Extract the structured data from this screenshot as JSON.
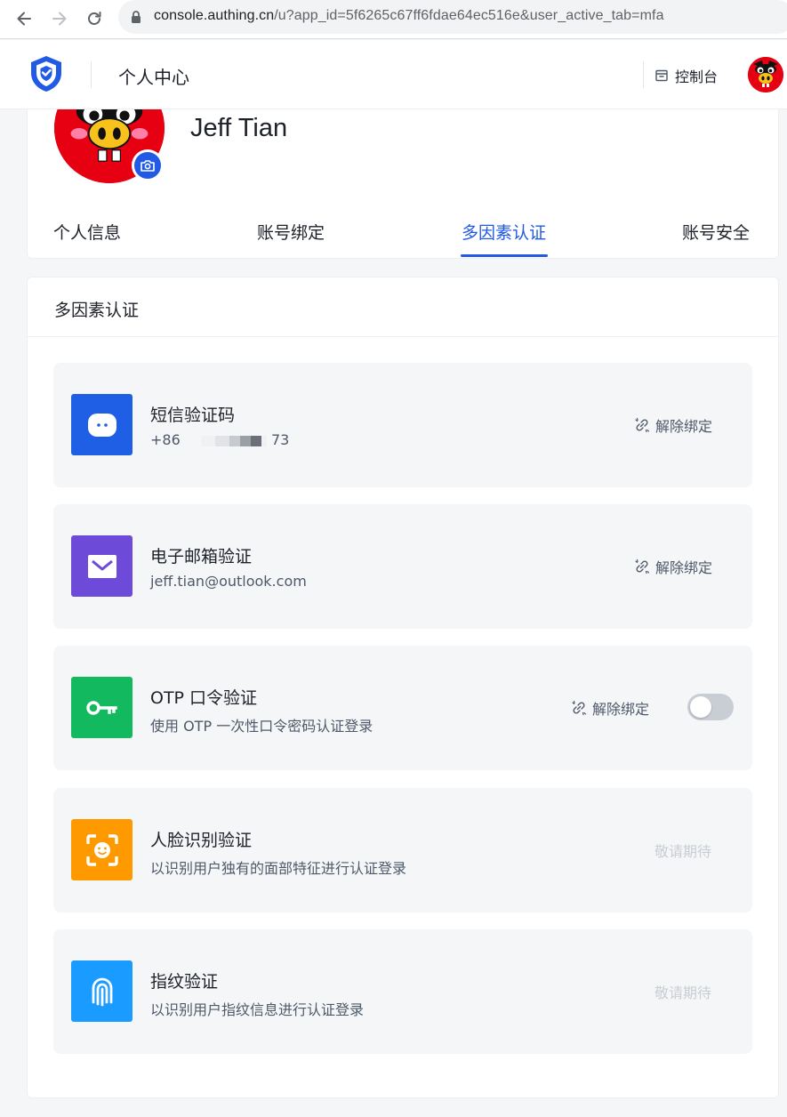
{
  "browser": {
    "url_domain": "console.authing.cn",
    "url_path": "/u?app_id=5f6265c67ff6fdae64ec516e&user_active_tab=mfa"
  },
  "header": {
    "title": "个人中心",
    "console_label": "控制台"
  },
  "profile": {
    "name": "Jeff Tian"
  },
  "tabs": [
    {
      "label": "个人信息"
    },
    {
      "label": "账号绑定"
    },
    {
      "label": "多因素认证"
    },
    {
      "label": "账号安全"
    }
  ],
  "active_tab": "多因素认证",
  "panel": {
    "title": "多因素认证"
  },
  "methods": [
    {
      "title": "短信验证码",
      "desc_prefix": "+86",
      "desc_suffix": "73",
      "action": "解除绑定",
      "icon": "chat-icon",
      "color": "#1f5fe6"
    },
    {
      "title": "电子邮箱验证",
      "desc": "jeff.tian@outlook.com",
      "action": "解除绑定",
      "icon": "mail-icon",
      "color": "#6d4bd8"
    },
    {
      "title": "OTP 口令验证",
      "desc": "使用 OTP 一次性口令密码认证登录",
      "action": "解除绑定",
      "icon": "key-icon",
      "color": "#12b95f",
      "toggle_on": false
    },
    {
      "title": "人脸识别验证",
      "desc": "以识别用户独有的面部特征进行认证登录",
      "action": "敬请期待",
      "icon": "face-scan-icon",
      "color": "#ff9900"
    },
    {
      "title": "指纹验证",
      "desc": "以识别用户指纹信息进行认证登录",
      "action": "敬请期待",
      "icon": "fingerprint-icon",
      "color": "#1a9bff"
    }
  ],
  "colors": {
    "accent": "#215ae5",
    "page_bg": "#f5f6f8"
  }
}
